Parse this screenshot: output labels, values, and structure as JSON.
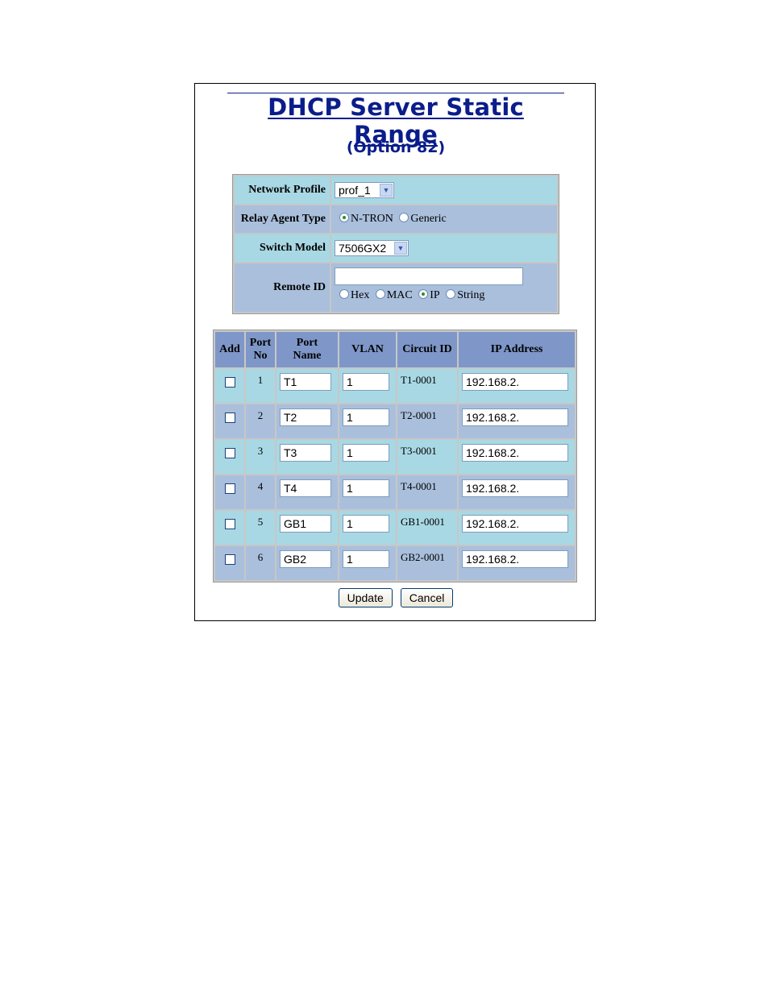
{
  "page": {
    "title": "DHCP Server Static Range",
    "subtitle": "(Option 82)"
  },
  "config": {
    "network_profile": {
      "label": "Network Profile",
      "value": "prof_1"
    },
    "relay_agent_type": {
      "label": "Relay Agent Type",
      "options": [
        "N-TRON",
        "Generic"
      ],
      "selected": "N-TRON"
    },
    "switch_model": {
      "label": "Switch Model",
      "value": "7506GX2"
    },
    "remote_id": {
      "label": "Remote ID",
      "value": "",
      "formats": [
        "Hex",
        "MAC",
        "IP",
        "String"
      ],
      "selected": "IP"
    }
  },
  "ports_table": {
    "headers": [
      "Add",
      "Port No",
      "Port Name",
      "VLAN",
      "Circuit ID",
      "IP Address"
    ],
    "rows": [
      {
        "add": false,
        "port_no": "1",
        "port_name": "T1",
        "vlan": "1",
        "circuit_id": "T1-0001",
        "ip": "192.168.2."
      },
      {
        "add": false,
        "port_no": "2",
        "port_name": "T2",
        "vlan": "1",
        "circuit_id": "T2-0001",
        "ip": "192.168.2."
      },
      {
        "add": false,
        "port_no": "3",
        "port_name": "T3",
        "vlan": "1",
        "circuit_id": "T3-0001",
        "ip": "192.168.2."
      },
      {
        "add": false,
        "port_no": "4",
        "port_name": "T4",
        "vlan": "1",
        "circuit_id": "T4-0001",
        "ip": "192.168.2."
      },
      {
        "add": false,
        "port_no": "5",
        "port_name": "GB1",
        "vlan": "1",
        "circuit_id": "GB1-0001",
        "ip": "192.168.2."
      },
      {
        "add": false,
        "port_no": "6",
        "port_name": "GB2",
        "vlan": "1",
        "circuit_id": "GB2-0001",
        "ip": "192.168.2."
      }
    ]
  },
  "buttons": {
    "update": "Update",
    "cancel": "Cancel"
  },
  "colors": {
    "title": "#0a1d8a",
    "row_light": "#a8d8e4",
    "row_dark": "#a9bfdc",
    "header": "#7e97c8"
  }
}
